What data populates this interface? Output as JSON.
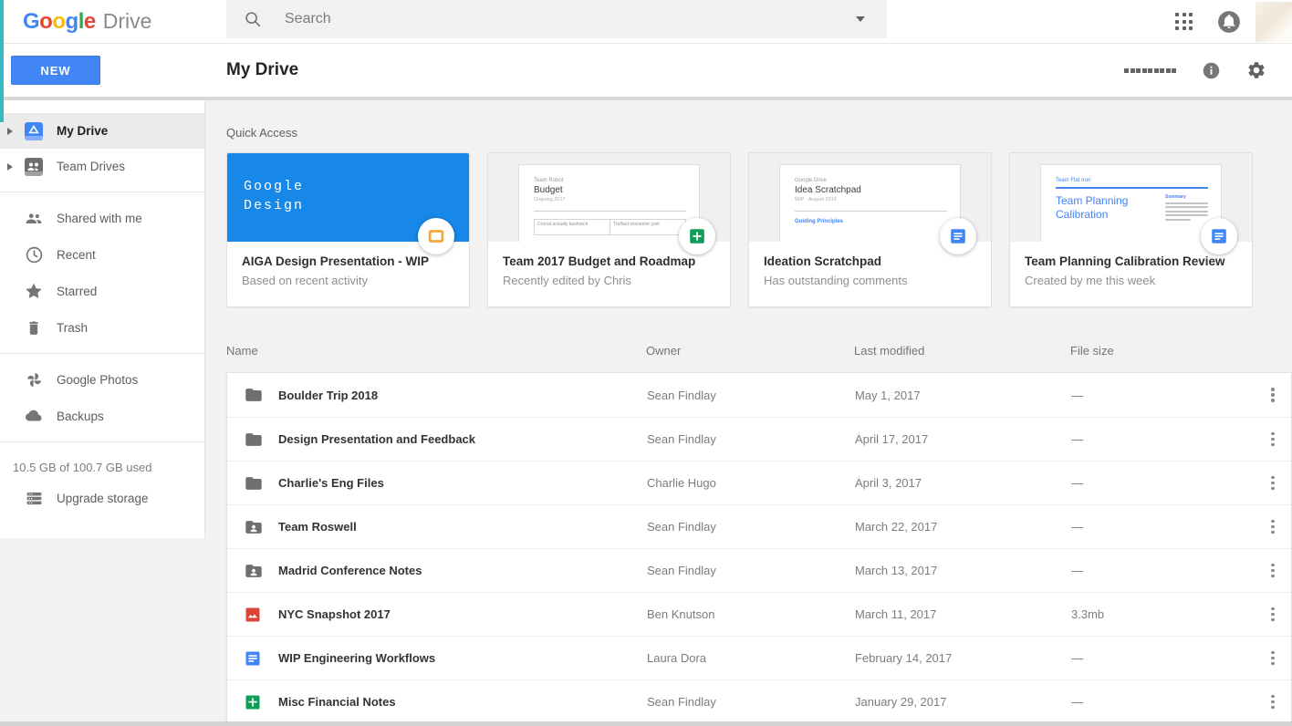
{
  "colors": {
    "accent_blue": "#4285f4",
    "thumb_blue": "#1787e8",
    "docs_blue": "#4285F4",
    "sheets_green": "#0F9D58",
    "slides_orange": "#F4B400",
    "image_red": "#DB4437",
    "teal_edge": "#38b8c0"
  },
  "header": {
    "logo_letters": [
      "G",
      "o",
      "o",
      "g",
      "l",
      "e"
    ],
    "logo_product": "Drive",
    "search_placeholder": "Search"
  },
  "toolbar": {
    "new_button": "NEW",
    "title": "My Drive"
  },
  "sidebar": {
    "items": [
      {
        "label": "My Drive",
        "icon": "drive",
        "active": true
      },
      {
        "label": "Team Drives",
        "icon": "team-drive",
        "active": false
      },
      {
        "label": "Shared with me",
        "icon": "people",
        "active": false
      },
      {
        "label": "Recent",
        "icon": "clock",
        "active": false
      },
      {
        "label": "Starred",
        "icon": "star",
        "active": false
      },
      {
        "label": "Trash",
        "icon": "trash",
        "active": false
      },
      {
        "label": "Google Photos",
        "icon": "photos",
        "active": false
      },
      {
        "label": "Backups",
        "icon": "cloud",
        "active": false
      }
    ],
    "storage_text": "10.5 GB of 100.7 GB used",
    "upgrade_label": "Upgrade storage"
  },
  "quick_access": {
    "label": "Quick Access",
    "cards": [
      {
        "title": "AIGA Design Presentation - WIP",
        "subtitle": "Based on recent activity",
        "badge": "slides",
        "thumb": {
          "line1": "Google",
          "line2": "Design"
        }
      },
      {
        "title": "Team 2017 Budget and Roadmap",
        "subtitle": "Recently edited by Chris",
        "badge": "sheets",
        "thumb": {
          "kicker": "Team Robot",
          "heading": "Budget",
          "sub": "Ongoing 2017",
          "cell1": "Cronut actually bushwick",
          "cell2": "Truffaut scenester york"
        }
      },
      {
        "title": "Ideation Scratchpad",
        "subtitle": "Has outstanding comments",
        "badge": "docs",
        "thumb": {
          "kicker": "Google Drive",
          "heading": "Idea Scratchpad",
          "sub": "WIP - August 2016",
          "link": "Guiding Principles"
        }
      },
      {
        "title": "Team Planning Calibration Review",
        "subtitle": "Created by me this week",
        "badge": "docs",
        "thumb": {
          "kicker": "Team Flat Iron",
          "heading": "Team Planning Calibration",
          "summary": "Summary"
        }
      }
    ]
  },
  "table": {
    "columns": {
      "name": "Name",
      "owner": "Owner",
      "modified": "Last modified",
      "size": "File size"
    },
    "rows": [
      {
        "icon": "folder",
        "name": "Boulder Trip 2018",
        "owner": "Sean Findlay",
        "modified": "May 1, 2017",
        "size": "—"
      },
      {
        "icon": "folder",
        "name": "Design Presentation and Feedback",
        "owner": "Sean Findlay",
        "modified": "April 17, 2017",
        "size": "—"
      },
      {
        "icon": "folder",
        "name": "Charlie's Eng Files",
        "owner": "Charlie Hugo",
        "modified": "April 3, 2017",
        "size": "—"
      },
      {
        "icon": "folder-shared",
        "name": "Team Roswell",
        "owner": "Sean Findlay",
        "modified": "March 22, 2017",
        "size": "—"
      },
      {
        "icon": "folder-shared",
        "name": "Madrid Conference Notes",
        "owner": "Sean Findlay",
        "modified": "March 13, 2017",
        "size": "—"
      },
      {
        "icon": "image",
        "name": "NYC Snapshot 2017",
        "owner": "Ben Knutson",
        "modified": "March 11, 2017",
        "size": "3.3mb"
      },
      {
        "icon": "docs",
        "name": "WIP Engineering Workflows",
        "owner": "Laura Dora",
        "modified": "February 14, 2017",
        "size": "—"
      },
      {
        "icon": "sheets",
        "name": "Misc Financial Notes",
        "owner": "Sean Findlay",
        "modified": "January 29, 2017",
        "size": "—"
      }
    ]
  }
}
